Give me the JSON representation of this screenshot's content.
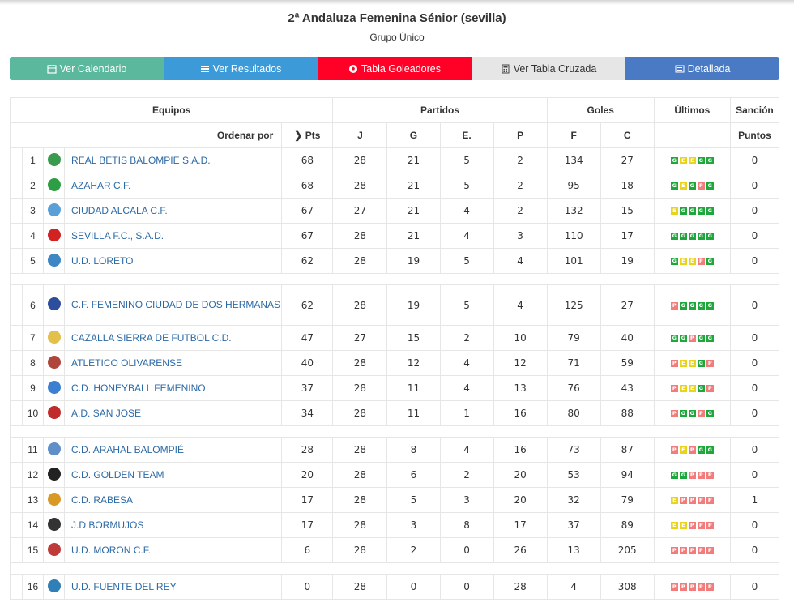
{
  "header": {
    "title": "2ª Andaluza Femenina Sénior (sevilla)",
    "subtitle": "Grupo Único"
  },
  "tabs": [
    {
      "label": "Ver Calendario",
      "icon": "calendar-icon",
      "color": "#5cb89c"
    },
    {
      "label": "Ver Resultados",
      "icon": "list-icon",
      "color": "#3d9ad8"
    },
    {
      "label": "Tabla Goleadores",
      "icon": "soccer-ball-icon",
      "color": "#ff0027"
    },
    {
      "label": "Ver Tabla Cruzada",
      "icon": "calculator-icon",
      "color": "#e6e6e6"
    },
    {
      "label": "Detallada",
      "icon": "detail-list-icon",
      "color": "#4a7ac3"
    }
  ],
  "table": {
    "group_headers": {
      "equipos": "Equipos",
      "partidos": "Partidos",
      "goles": "Goles",
      "ultimos": "Últimos",
      "sancion": "Sanción"
    },
    "sub_headers": {
      "ordenar": "Ordenar por",
      "pts": "Pts",
      "j": "J",
      "g": "G",
      "e": "E.",
      "p": "P",
      "f": "F",
      "c": "C",
      "puntos": "Puntos"
    },
    "rows": [
      {
        "pos": "1",
        "team": "REAL BETIS BALOMPIE S.A.D.",
        "pts": "68",
        "j": "28",
        "g": "21",
        "e": "5",
        "p": "2",
        "f": "134",
        "c": "27",
        "last": [
          "G",
          "E",
          "E",
          "G",
          "G"
        ],
        "sancion": "0",
        "crest": "#3a9b4e"
      },
      {
        "pos": "2",
        "team": "AZAHAR C.F.",
        "pts": "68",
        "j": "28",
        "g": "21",
        "e": "5",
        "p": "2",
        "f": "95",
        "c": "18",
        "last": [
          "G",
          "E",
          "G",
          "P",
          "G"
        ],
        "sancion": "0",
        "crest": "#2e9e44"
      },
      {
        "pos": "3",
        "team": "CIUDAD ALCALA C.F.",
        "pts": "67",
        "j": "27",
        "g": "21",
        "e": "4",
        "p": "2",
        "f": "132",
        "c": "15",
        "last": [
          "E",
          "G",
          "G",
          "G",
          "G"
        ],
        "sancion": "0",
        "crest": "#5aa0d8"
      },
      {
        "pos": "4",
        "team": "SEVILLA F.C., S.A.D.",
        "pts": "67",
        "j": "28",
        "g": "21",
        "e": "4",
        "p": "3",
        "f": "110",
        "c": "17",
        "last": [
          "G",
          "G",
          "G",
          "G",
          "G"
        ],
        "sancion": "0",
        "crest": "#d32222"
      },
      {
        "pos": "5",
        "team": "U.D. LORETO",
        "pts": "62",
        "j": "28",
        "g": "19",
        "e": "5",
        "p": "4",
        "f": "101",
        "c": "19",
        "last": [
          "G",
          "E",
          "E",
          "P",
          "G"
        ],
        "sancion": "0",
        "crest": "#3e86c4"
      },
      {
        "pos": "6",
        "team": "C.F. FEMENINO CIUDAD DE DOS HERMANAS",
        "pts": "62",
        "j": "28",
        "g": "19",
        "e": "5",
        "p": "4",
        "f": "125",
        "c": "27",
        "last": [
          "P",
          "G",
          "G",
          "G",
          "G"
        ],
        "sancion": "0",
        "crest": "#2d4e9c"
      },
      {
        "pos": "7",
        "team": "CAZALLA SIERRA DE FUTBOL C.D.",
        "pts": "47",
        "j": "27",
        "g": "15",
        "e": "2",
        "p": "10",
        "f": "79",
        "c": "40",
        "last": [
          "G",
          "G",
          "P",
          "G",
          "G"
        ],
        "sancion": "0",
        "crest": "#e3c04a"
      },
      {
        "pos": "8",
        "team": "ATLETICO OLIVARENSE",
        "pts": "40",
        "j": "28",
        "g": "12",
        "e": "4",
        "p": "12",
        "f": "71",
        "c": "59",
        "last": [
          "P",
          "E",
          "E",
          "G",
          "P"
        ],
        "sancion": "0",
        "crest": "#b0463a"
      },
      {
        "pos": "9",
        "team": "C.D. HONEYBALL FEMENINO",
        "pts": "37",
        "j": "28",
        "g": "11",
        "e": "4",
        "p": "13",
        "f": "76",
        "c": "43",
        "last": [
          "P",
          "E",
          "E",
          "G",
          "P"
        ],
        "sancion": "0",
        "crest": "#3b7fd1"
      },
      {
        "pos": "10",
        "team": "A.D. SAN JOSE",
        "pts": "34",
        "j": "28",
        "g": "11",
        "e": "1",
        "p": "16",
        "f": "80",
        "c": "88",
        "last": [
          "P",
          "G",
          "G",
          "P",
          "G"
        ],
        "sancion": "0",
        "crest": "#c02b2b"
      },
      {
        "pos": "11",
        "team": "C.D. ARAHAL BALOMPIÉ",
        "pts": "28",
        "j": "28",
        "g": "8",
        "e": "4",
        "p": "16",
        "f": "73",
        "c": "87",
        "last": [
          "P",
          "E",
          "P",
          "G",
          "G"
        ],
        "sancion": "0",
        "crest": "#5f8fc9"
      },
      {
        "pos": "12",
        "team": "C.D. GOLDEN TEAM",
        "pts": "20",
        "j": "28",
        "g": "6",
        "e": "2",
        "p": "20",
        "f": "53",
        "c": "94",
        "last": [
          "G",
          "G",
          "P",
          "P",
          "P"
        ],
        "sancion": "0",
        "crest": "#222222"
      },
      {
        "pos": "13",
        "team": "C.D. RABESA",
        "pts": "17",
        "j": "28",
        "g": "5",
        "e": "3",
        "p": "20",
        "f": "32",
        "c": "79",
        "last": [
          "E",
          "P",
          "P",
          "P",
          "P"
        ],
        "sancion": "1",
        "crest": "#d89a25"
      },
      {
        "pos": "14",
        "team": "J.D BORMUJOS",
        "pts": "17",
        "j": "28",
        "g": "3",
        "e": "8",
        "p": "17",
        "f": "37",
        "c": "89",
        "last": [
          "E",
          "E",
          "P",
          "P",
          "P"
        ],
        "sancion": "0",
        "crest": "#333333"
      },
      {
        "pos": "15",
        "team": "U.D. MORON C.F.",
        "pts": "6",
        "j": "28",
        "g": "2",
        "e": "0",
        "p": "26",
        "f": "13",
        "c": "205",
        "last": [
          "P",
          "P",
          "P",
          "P",
          "P"
        ],
        "sancion": "0",
        "crest": "#c03a3a"
      },
      {
        "pos": "16",
        "team": "U.D. FUENTE DEL REY",
        "pts": "0",
        "j": "28",
        "g": "0",
        "e": "0",
        "p": "28",
        "f": "4",
        "c": "308",
        "last": [
          "P",
          "P",
          "P",
          "P",
          "P"
        ],
        "sancion": "0",
        "crest": "#2f7fb8"
      }
    ]
  }
}
